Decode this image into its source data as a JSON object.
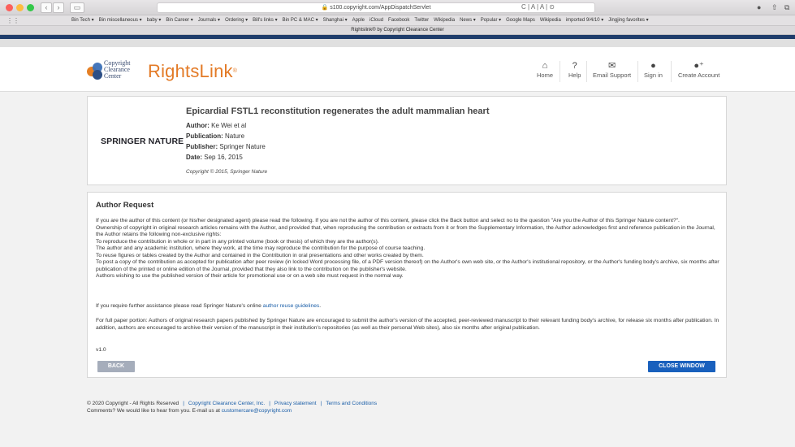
{
  "browser": {
    "url": "s100.copyright.com/AppDispatchServlet",
    "tab_title": "Rightslink® by Copyright Clearance Center",
    "favorites": [
      "Bin Tech ▾",
      "Bin miscellaneous ▾",
      "baby ▾",
      "Bin Career ▾",
      "Journals ▾",
      "Ordering ▾",
      "Bill's links ▾",
      "Bin PC & MAC ▾",
      "Shanghai ▾",
      "Apple",
      "iCloud",
      "Facebook",
      "Twitter",
      "Wikipedia",
      "News ▾",
      "Popular ▾",
      "Google Maps",
      "Wikipedia",
      "imported 9/4/10 ▾",
      "Jingjing favorites ▾"
    ],
    "reader_controls": "C | A | A | ⊙"
  },
  "header": {
    "ccc_logo_line1": "Copyright",
    "ccc_logo_line2": "Clearance",
    "ccc_logo_line3": "Center",
    "brand": "RightsLink",
    "brand_mark": "®",
    "nav": [
      {
        "label": "Home",
        "icon": "home-icon"
      },
      {
        "label": "Help",
        "icon": "help-icon"
      },
      {
        "label": "Email Support",
        "icon": "email-icon"
      },
      {
        "label": "Sign in",
        "icon": "user-icon"
      },
      {
        "label": "Create Account",
        "icon": "add-user-icon"
      }
    ]
  },
  "article": {
    "publisher_logo": "SPRINGER NATURE",
    "title": "Epicardial FSTL1 reconstitution regenerates the adult mammalian heart",
    "author_label": "Author:",
    "author": "Ke Wei et al",
    "publication_label": "Publication:",
    "publication": "Nature",
    "publisher_label": "Publisher:",
    "publisher": "Springer Nature",
    "date_label": "Date:",
    "date": "Sep 16, 2015",
    "copyright": "Copyright © 2015, Springer Nature"
  },
  "request": {
    "title": "Author Request",
    "p1": "If you are the author of this content (or his/her designated agent) please read the following. If you are not the author of this content, please click the Back button and select no to the question \"Are you the Author of this Springer Nature content?\".",
    "p2": "Ownership of copyright in original research articles remains with the Author, and provided that, when reproducing the contribution or extracts from it or from the Supplementary Information, the Author acknowledges first and reference publication in the Journal, the Author retains the following non-exclusive rights:",
    "p3": "To reproduce the contribution in whole or in part in any printed volume (book or thesis) of which they are the author(s).",
    "p4": "The author and any academic institution, where they work, at the time may reproduce the contribution for the purpose of course teaching.",
    "p5": "To reuse figures or tables created by the Author and contained in the Contribution in oral presentations and other works created by them.",
    "p6": "To post a copy of the contribution as accepted for publication after peer review (in locked Word processing file, of a PDF version thereof) on the Author's own web site, or the Author's institutional repository, or the Author's funding body's archive, six months after publication of the printed or online edition of the Journal, provided that they also link to the contribution on the publisher's website.",
    "p7": "Authors wishing to use the published version of their article for promotional use or on a web site must request in the normal way.",
    "assist_text": "If you require further assistance please read Springer Nature's online ",
    "assist_link": "author reuse guidelines",
    "assist_end": ".",
    "p8": "For full paper portion: Authors of original research papers published by Springer Nature are encouraged to submit the author's version of the accepted, peer-reviewed manuscript to their relevant funding body's archive, for release six months after publication. In addition, authors are encouraged to archive their version of the manuscript in their institution's repositories (as well as their personal Web sites), also six months after original publication.",
    "version": "v1.0",
    "back_label": "BACK",
    "close_label": "CLOSE WINDOW"
  },
  "footer": {
    "copyright": "© 2020 Copyright - All Rights Reserved",
    "ccc_link": "Copyright Clearance Center, Inc.",
    "privacy_link": "Privacy statement",
    "terms_link": "Terms and Conditions",
    "comments_text": "Comments? We would like to hear from you. E-mail us at ",
    "email_link": "customercare@copyright.com"
  }
}
